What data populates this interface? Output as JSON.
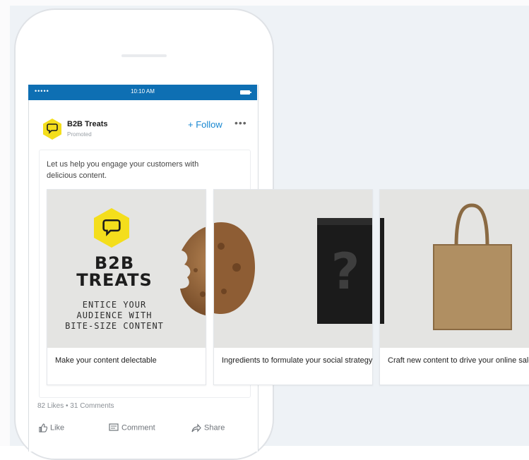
{
  "status_bar": {
    "signal": "•••••",
    "time": "10:10 AM"
  },
  "post": {
    "company": "B2B Treats",
    "promoted": "Promoted",
    "follow_label": "+ Follow",
    "more": "•••",
    "text": "Let us help you engage your customers with delicious content."
  },
  "cards": [
    {
      "brand_line1": "B2B",
      "brand_line2": "TREATS",
      "tagline": [
        "ENTICE YOUR",
        "AUDIENCE WITH",
        "BITE-SIZE CONTENT"
      ],
      "caption": "Make your content delectable",
      "image_icon": "cookie-icon"
    },
    {
      "caption": "Ingredients to formulate your social strategy",
      "image_icon": "mystery-bag-icon"
    },
    {
      "caption": "Craft new content to drive your online sales",
      "image_icon": "tote-bag-icon"
    }
  ],
  "social": {
    "stats": "82 Likes • 31 Comments",
    "like_label": "Like",
    "comment_label": "Comment",
    "share_label": "Share"
  },
  "colors": {
    "linkedin_blue": "#0e6fb3",
    "follow_blue": "#1787d1",
    "brand_yellow": "#f4de1c",
    "panel_bg": "#eef2f6"
  }
}
